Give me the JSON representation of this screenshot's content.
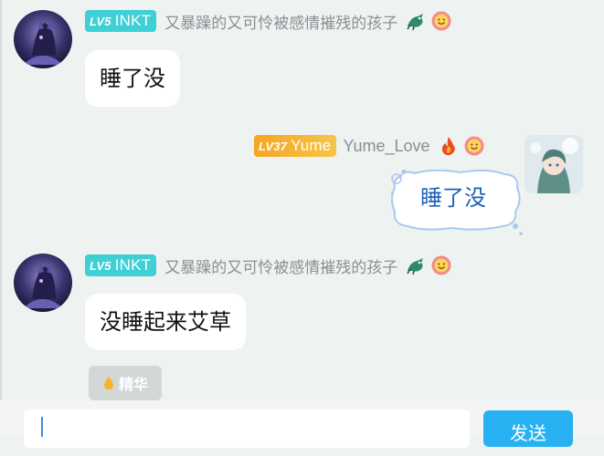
{
  "messages": [
    {
      "side": "left",
      "level": "LV5",
      "badge": "INKT",
      "username": "又暴躁的又可怜被感情摧残的孩子",
      "text": "睡了没",
      "icons": [
        "dragon-icon",
        "smiley-face-icon"
      ]
    },
    {
      "side": "right",
      "level": "LV37",
      "badge": "Yume",
      "username": "Yume_Love",
      "text": "睡了没",
      "icons": [
        "fire-icon",
        "smiley-face-icon"
      ]
    },
    {
      "side": "left",
      "level": "LV5",
      "badge": "INKT",
      "username": "又暴躁的又可怜被感情摧残的孩子",
      "text": "没睡起来艾草",
      "icons": [
        "dragon-icon",
        "smiley-face-icon"
      ],
      "tag": "精华"
    }
  ],
  "composer": {
    "placeholder": "",
    "send_label": "发送"
  },
  "colors": {
    "background": "#eef2f1",
    "level_teal": "#3fcfd6",
    "level_gold": "#f5a623",
    "send_button": "#27b1f3",
    "right_bubble_text": "#1f5fb8"
  }
}
